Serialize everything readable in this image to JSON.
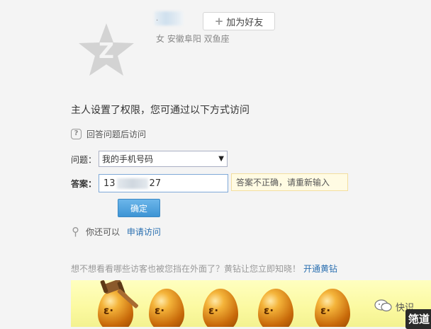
{
  "profile": {
    "name_partial": "·",
    "add_friend_label": "加为好友",
    "meta": "女 安徽阜阳 双鱼座"
  },
  "permission": {
    "title": "主人设置了权限，您可通过以下方式访问",
    "answer_mode_label": "回答问题后访问",
    "question_label": "问题：",
    "question_selected": "我的手机号码",
    "answer_label": "答案：",
    "answer_value_start": "13",
    "answer_value_end": "27",
    "error_tip": "答案不正确，请重新输入",
    "confirm_label": "确定",
    "apply_prefix": "你还可以",
    "apply_link": "申请访问"
  },
  "promo": {
    "text": "想不想看看哪些访客也被您挡在外面了？黄钻让您立即知晓！",
    "link": "开通黄钻"
  },
  "watermark": {
    "text": "快识",
    "badge": "筂道"
  },
  "colors": {
    "accent": "#3d94d4",
    "link": "#2a6fb0",
    "tip_bg": "#fffbe3"
  }
}
